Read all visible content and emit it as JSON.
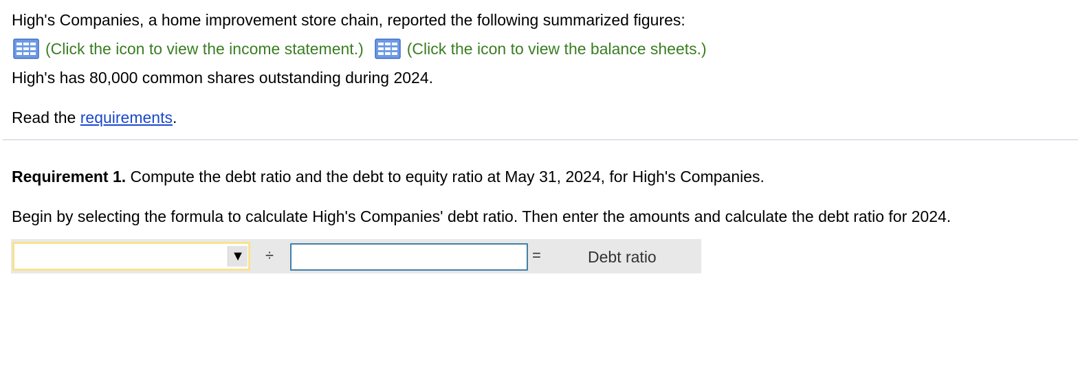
{
  "intro_text": "High's Companies, a home improvement store chain, reported the following summarized figures:",
  "links": {
    "income_statement": "(Click the icon to view the income statement.)",
    "balance_sheets": "(Click the icon to view the balance sheets.)",
    "icon": "table-grid-icon",
    "link_color": "#3a7d22"
  },
  "shares_text": "High's has 80,000 common shares outstanding during 2024.",
  "read_requirements": {
    "prefix": "Read the ",
    "link": "requirements",
    "suffix": "."
  },
  "requirement1": {
    "label": "Requirement 1.",
    "text": " Compute the debt ratio and the debt to equity ratio at May 31, 2024, for High's Companies."
  },
  "instruction": "Begin by selecting the formula to calculate High's Companies' debt ratio. Then enter the amounts and calculate the debt ratio for 2024.",
  "formula": {
    "select_value": "",
    "select_arrow": "▼",
    "divide_symbol": "÷",
    "input_value": "",
    "equals_symbol": "=",
    "result_label": "Debt ratio"
  }
}
